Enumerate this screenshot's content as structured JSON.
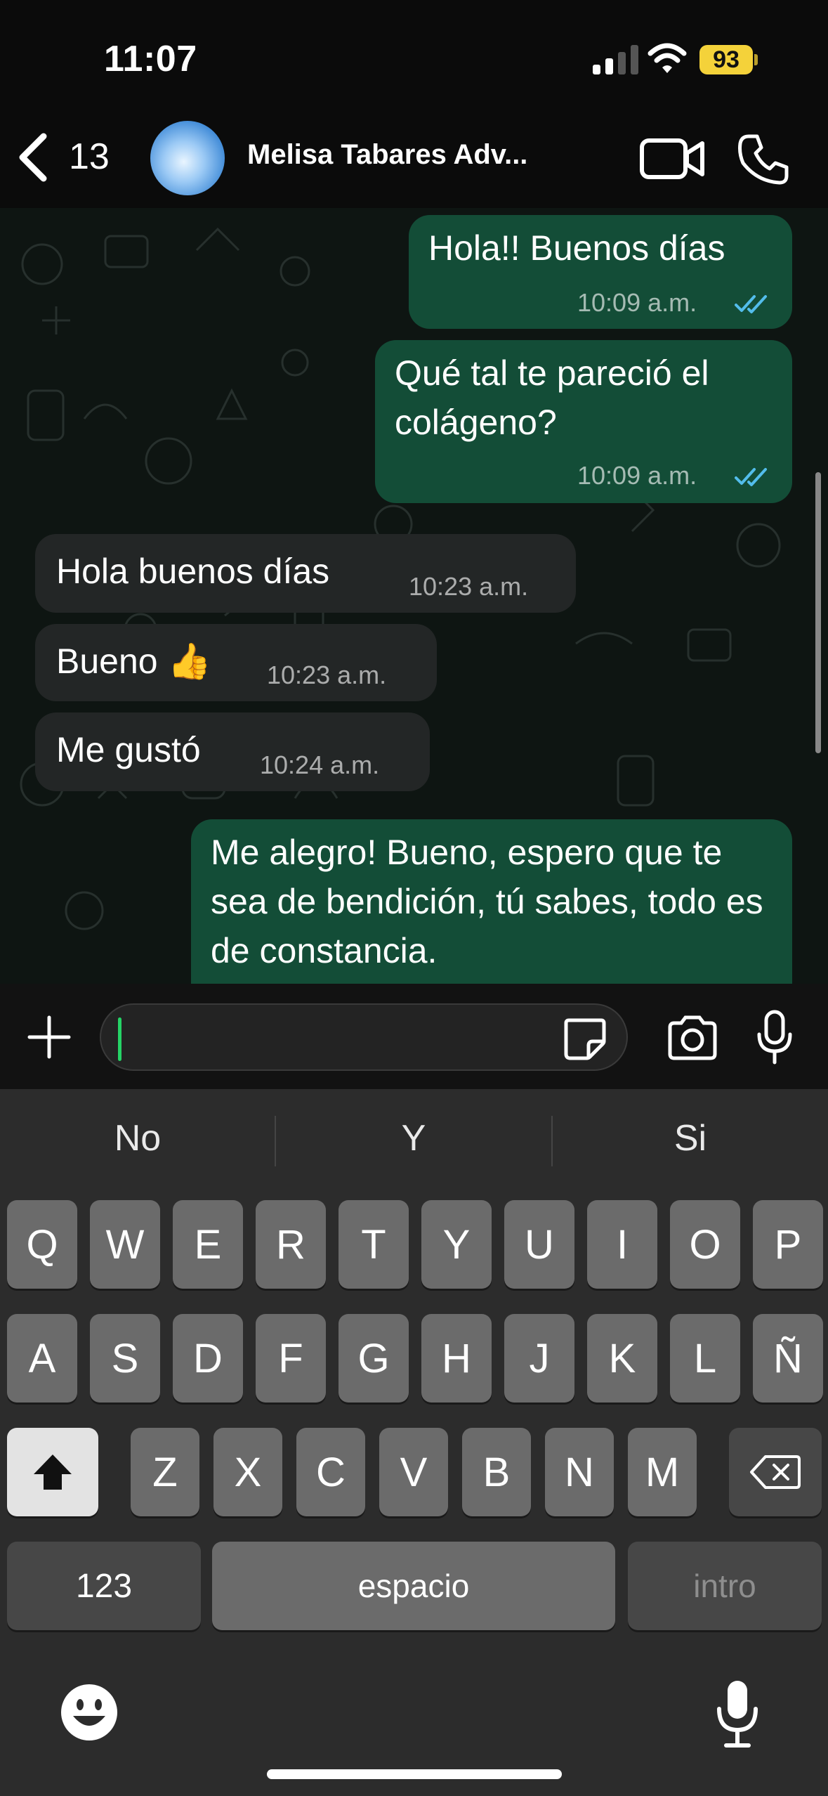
{
  "status": {
    "time": "11:07",
    "battery": "93"
  },
  "header": {
    "back_count": "13",
    "contact_name": "Melisa Tabares Adv..."
  },
  "messages": [
    {
      "direction": "outgoing",
      "text": "Hola!! Buenos días",
      "time": "10:09 a.m.",
      "read": true
    },
    {
      "direction": "outgoing",
      "text": "Qué tal te pareció el colágeno?",
      "time": "10:09 a.m.",
      "read": true
    },
    {
      "direction": "incoming",
      "text": "Hola buenos días",
      "time": "10:23 a.m."
    },
    {
      "direction": "incoming",
      "text": "Bueno 👍",
      "time": "10:23 a.m."
    },
    {
      "direction": "incoming",
      "text": "Me gustó",
      "time": "10:24 a.m."
    },
    {
      "direction": "outgoing",
      "text": "Me alegro! Bueno, espero que te sea de bendición, tú sabes, todo es de constancia."
    }
  ],
  "input": {
    "value": ""
  },
  "keyboard": {
    "suggestions": [
      "No",
      "Y",
      "Si"
    ],
    "row1": [
      "Q",
      "W",
      "E",
      "R",
      "T",
      "Y",
      "U",
      "I",
      "O",
      "P"
    ],
    "row2": [
      "A",
      "S",
      "D",
      "F",
      "G",
      "H",
      "J",
      "K",
      "L",
      "Ñ"
    ],
    "row3": [
      "Z",
      "X",
      "C",
      "V",
      "B",
      "N",
      "M"
    ],
    "numbers_label": "123",
    "space_label": "espacio",
    "return_label": "intro"
  },
  "colors": {
    "outgoing_bubble": "#134d37",
    "incoming_bubble": "#232626",
    "read_tick": "#53bdeb",
    "cursor": "#25d366",
    "battery": "#f4d23a"
  }
}
